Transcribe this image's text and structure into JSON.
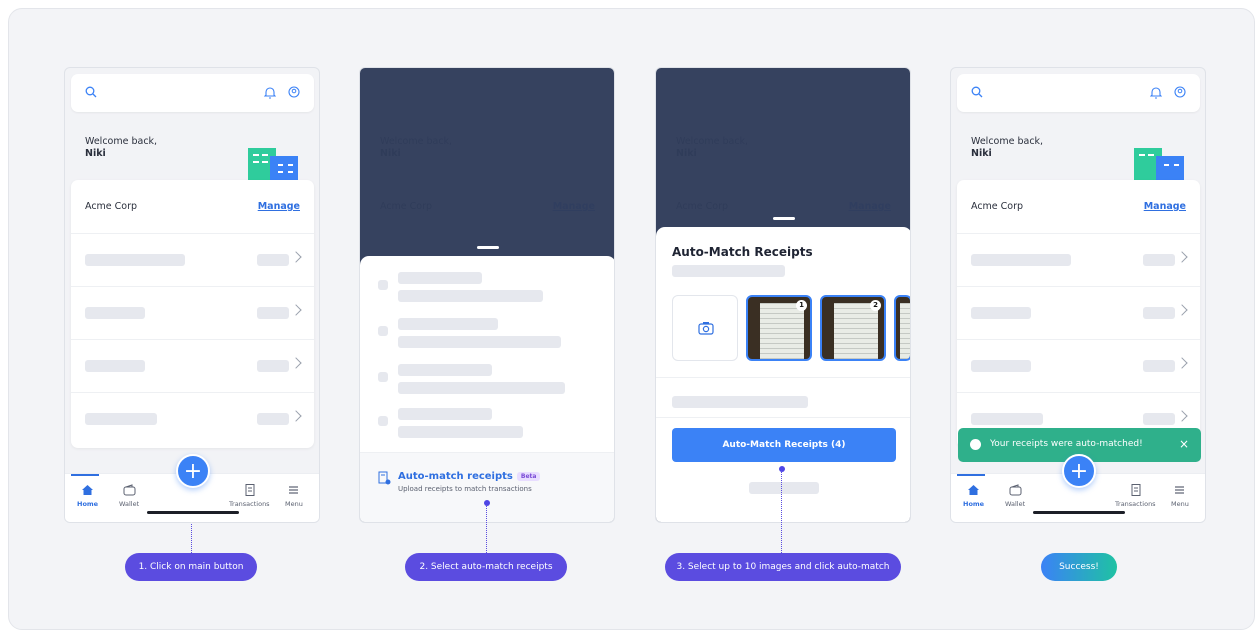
{
  "colors": {
    "primary": "#3b82f6",
    "step_pill": "#5b4ce0",
    "toast": "#2fb08b",
    "overlay": "#1b294a"
  },
  "home": {
    "welcome_line1": "Welcome back,",
    "welcome_name": "Niki",
    "org_name": "Acme Corp",
    "manage_label": "Manage"
  },
  "tabbar": {
    "tabs": [
      {
        "label": "Home",
        "icon": "home-icon"
      },
      {
        "label": "Wallet",
        "icon": "wallet-icon"
      },
      {
        "label": "Transactions",
        "icon": "receipt-icon"
      },
      {
        "label": "Menu",
        "icon": "menu-icon"
      }
    ],
    "fab_label": "+"
  },
  "action_sheet": {
    "auto_match_title": "Auto-match receipts",
    "beta_label": "Beta",
    "auto_match_subtitle": "Upload receipts to match transactions"
  },
  "auto_match": {
    "title": "Auto-Match Receipts",
    "thumb_badges": [
      "1",
      "2"
    ],
    "button_label": "Auto-Match Receipts (4)"
  },
  "toast": {
    "message": "Your receipts were auto-matched!",
    "close": "×"
  },
  "steps": [
    "1. Click on main button",
    "2. Select auto-match receipts",
    "3. Select up to 10 images and click auto-match",
    "Success!"
  ]
}
